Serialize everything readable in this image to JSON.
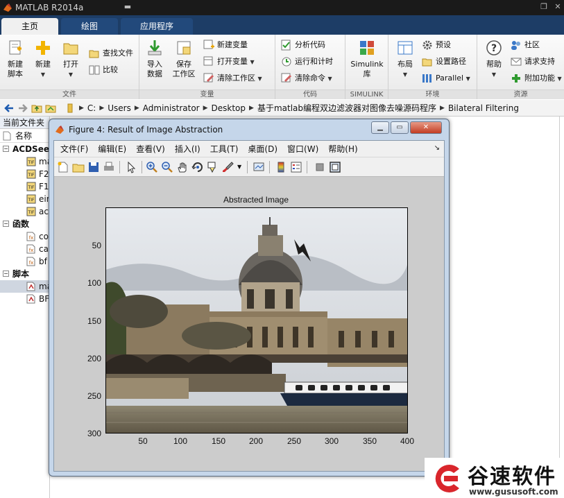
{
  "app": {
    "title": "MATLAB R2014a"
  },
  "tabs": [
    {
      "label": "主页"
    },
    {
      "label": "绘图"
    },
    {
      "label": "应用程序"
    }
  ],
  "ribbon": {
    "groups": {
      "file": "文件",
      "variable": "变量",
      "code": "代码",
      "simulink": "SIMULINK",
      "env": "环境",
      "resource": "资源"
    },
    "new_script": "新建\n脚本",
    "new_script_l1": "新建",
    "new_script_l2": "脚本",
    "new": "新建",
    "open": "打开",
    "find_files": "查找文件",
    "compare": "比较",
    "import_l1": "导入",
    "import_l2": "数据",
    "save_l1": "保存",
    "save_l2": "工作区",
    "new_var": "新建变量",
    "open_var": "打开变量",
    "clear_ws": "清除工作区",
    "analyze": "分析代码",
    "run_time": "运行和计时",
    "clear_cmd": "清除命令",
    "simulink_l1": "Simulink",
    "simulink_l2": "库",
    "layout": "布局",
    "prefs": "预设",
    "set_path": "设置路径",
    "parallel": "Parallel",
    "help": "帮助",
    "community": "社区",
    "request_support": "请求支持",
    "addons": "附加功能"
  },
  "address": {
    "crumbs": [
      "C:",
      "Users",
      "Administrator",
      "Desktop",
      "基于matlab编程双边滤波器对图像去噪源码程序",
      "Bilateral Filtering"
    ]
  },
  "left_panel": {
    "header": "当前文件夹",
    "column": "名称",
    "sections": [
      {
        "name": "ACDSee",
        "items": [
          "ma",
          "F2",
          "F1",
          "ein",
          "ac"
        ]
      },
      {
        "name": "函数",
        "items": [
          "co",
          "ca",
          "bf"
        ]
      },
      {
        "name": "脚本",
        "items": [
          "ma",
          "BF"
        ]
      }
    ]
  },
  "figure": {
    "title": "Figure 4: Result of Image Abstraction",
    "menu": [
      "文件(F)",
      "编辑(E)",
      "查看(V)",
      "插入(I)",
      "工具(T)",
      "桌面(D)",
      "窗口(W)",
      "帮助(H)"
    ],
    "axes_title": "Abstracted Image",
    "yticks": [
      "50",
      "100",
      "150",
      "200",
      "250",
      "300"
    ],
    "xticks": [
      "50",
      "100",
      "150",
      "200",
      "250",
      "300",
      "350",
      "400"
    ]
  },
  "watermark": {
    "text": "谷速软件",
    "url": "www.gususoft.com"
  },
  "colors": {
    "title_bar": "#1a1a1a",
    "tab_bar": "#1d3d66",
    "ribbon": "#f0f0f0",
    "figure_frame": "#c5d6ea",
    "watermark_red": "#d9262c"
  }
}
